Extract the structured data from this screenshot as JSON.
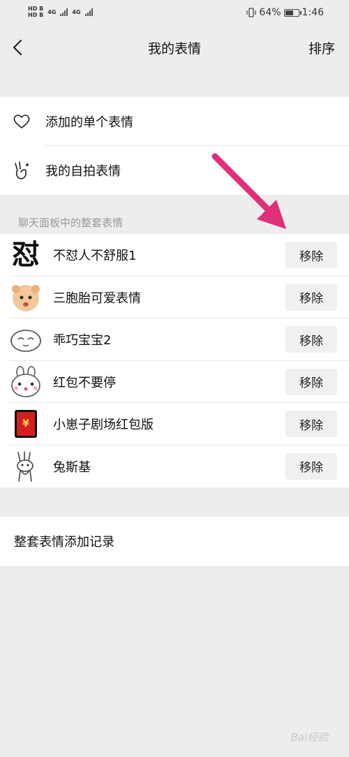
{
  "status_bar": {
    "left_chip_top": "HD B",
    "left_chip_bottom": "HD B",
    "net1": "4G",
    "net2": "4G",
    "battery_text": "64%",
    "battery_level": 0.64,
    "time": "1:46"
  },
  "nav": {
    "back_icon": "chevron-left-icon",
    "title": "我的表情",
    "sort_label": "排序"
  },
  "top_items": [
    {
      "icon": "heart-icon",
      "label": "添加的单个表情"
    },
    {
      "icon": "victory-hand-icon",
      "label": "我的自拍表情"
    }
  ],
  "section_title": "聊天面板中的整套表情",
  "packs": [
    {
      "name": "不怼人不舒服1",
      "thumb_text": "怼",
      "button": "移除"
    },
    {
      "name": "三胞胎可爱表情",
      "button": "移除"
    },
    {
      "name": "乖巧宝宝2",
      "button": "移除"
    },
    {
      "name": "红包不要停",
      "button": "移除"
    },
    {
      "name": "小崽子剧场红包版",
      "thumb_text": "¥",
      "button": "移除"
    },
    {
      "name": "兔斯基",
      "button": "移除"
    }
  ],
  "history_label": "整套表情添加记录",
  "watermark": "Bai经验",
  "colors": {
    "background": "#ededed",
    "card": "#ffffff",
    "arrow": "#e0307a",
    "button_bg": "#f0f0f0",
    "red_packet": "#d41f1f"
  }
}
